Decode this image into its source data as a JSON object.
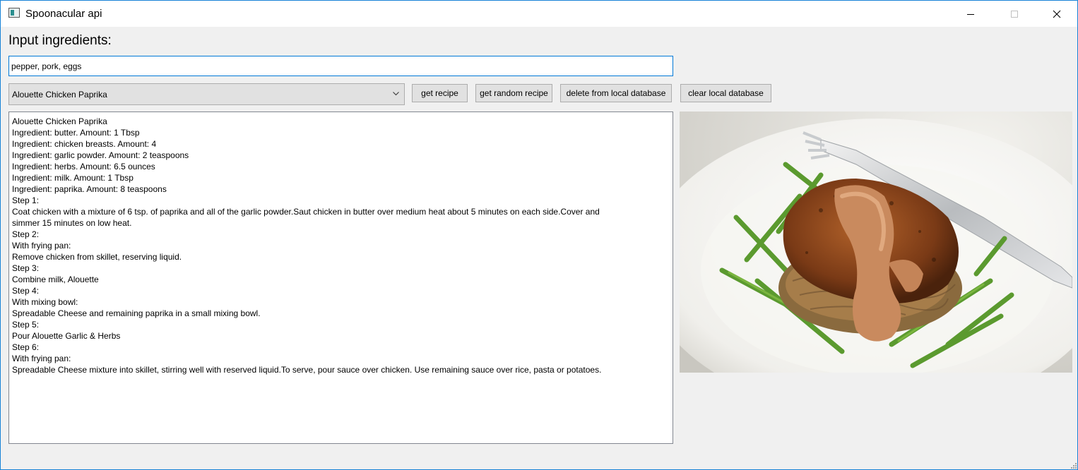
{
  "window": {
    "title": "Spoonacular api"
  },
  "heading": "Input ingredients:",
  "ingredients_input": {
    "value": "pepper, pork, eggs"
  },
  "recipe_select": {
    "selected": "Alouette Chicken Paprika"
  },
  "buttons": {
    "get_recipe": "get recipe",
    "get_random_recipe": "get random recipe",
    "delete_from_local_db": "delete from local database",
    "clear_local_db": "clear local database"
  },
  "recipe_text": [
    "Alouette Chicken Paprika",
    "Ingredient: butter. Amount: 1 Tbsp",
    "Ingredient: chicken breasts. Amount: 4",
    "Ingredient: garlic powder. Amount: 2 teaspoons",
    "Ingredient: herbs. Amount: 6.5 ounces",
    "Ingredient: milk. Amount: 1 Tbsp",
    "Ingredient: paprika. Amount: 8 teaspoons",
    "Step 1:",
    "Coat chicken with a mixture of 6 tsp. of paprika and all of the garlic powder.Saut chicken in butter over medium heat about 5 minutes on each side.Cover and",
    "simmer 15 minutes on low heat.",
    "Step 2:",
    "With frying pan:",
    "Remove chicken from skillet, reserving liquid.",
    "Step 3:",
    "Combine milk, Alouette",
    "Step 4:",
    "With mixing bowl:",
    "Spreadable Cheese and remaining paprika in a small mixing bowl.",
    "Step 5:",
    "Pour Alouette Garlic & Herbs",
    "Step 6:",
    "With frying pan:",
    "Spreadable Cheese mixture into skillet, stirring well with reserved liquid.To serve, pour sauce over chicken. Use remaining sauce over rice, pasta or potatoes."
  ],
  "colors": {
    "window_bg": "#f0f0f0",
    "focus_border": "#0078d7",
    "button_bg": "#e1e1e1"
  },
  "icons": {
    "app": "app-icon",
    "minimize": "minimize-icon",
    "maximize": "maximize-icon",
    "close": "close-icon",
    "dropdown": "chevron-down-icon",
    "resize": "resize-grip-icon"
  }
}
